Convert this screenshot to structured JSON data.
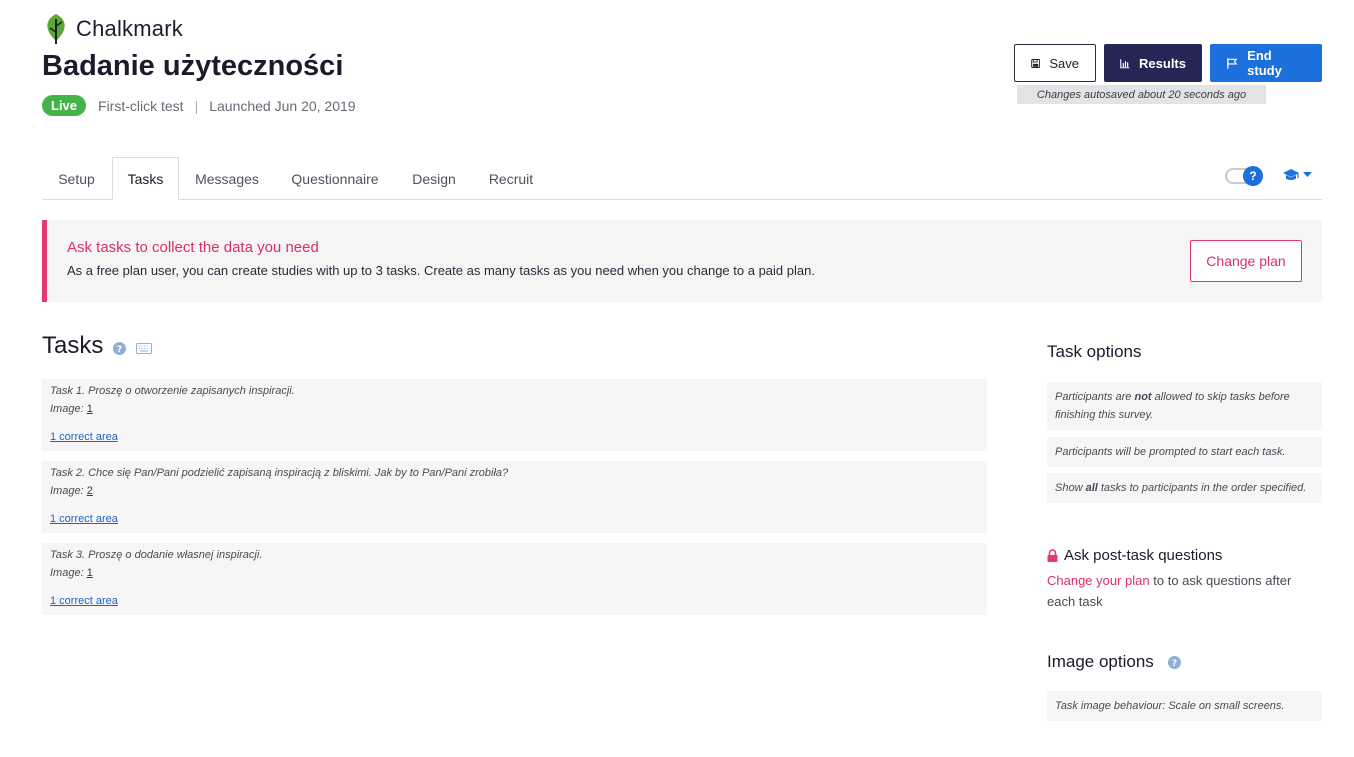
{
  "brand": {
    "name": "Chalkmark"
  },
  "study": {
    "title": "Badanie użyteczności",
    "status": "Live",
    "type": "First-click test",
    "separator": "|",
    "launched": "Launched Jun 20, 2019"
  },
  "actions": {
    "save": "Save",
    "results": "Results",
    "end_study": "End study",
    "autosave": "Changes autosaved about 20 seconds ago"
  },
  "tabs": [
    "Setup",
    "Tasks",
    "Messages",
    "Questionnaire",
    "Design",
    "Recruit"
  ],
  "active_tab": "Tasks",
  "toggle": {
    "knob": "?"
  },
  "banner": {
    "title": "Ask tasks to collect the data you need",
    "text": "As a free plan user, you can create studies with up to 3 tasks. Create as many tasks as you need when you change to a paid plan.",
    "button": "Change plan"
  },
  "tasks": {
    "title": "Tasks",
    "items": [
      {
        "question": "Task 1. Proszę o otworzenie zapisanych inspiracji.",
        "image_label": "Image:",
        "image": "1",
        "area": "1 correct area"
      },
      {
        "question": "Task 2. Chce się Pan/Pani podzielić zapisaną inspiracją z bliskimi. Jak by to Pan/Pani zrobiła?",
        "image_label": "Image:",
        "image": "2",
        "area": "1 correct area"
      },
      {
        "question": "Task 3. Proszę o dodanie własnej inspiracji.",
        "image_label": "Image:",
        "image": "1",
        "area": "1 correct area"
      }
    ]
  },
  "task_options": {
    "title": "Task options",
    "opt1_pre": "Participants are ",
    "opt1_bold": "not",
    "opt1_post": " allowed to skip tasks before finishing this survey.",
    "opt2": "Participants will be prompted to start each task.",
    "opt3_pre": "Show ",
    "opt3_bold": "all",
    "opt3_post": " tasks to participants in the order specified."
  },
  "post_task": {
    "title": "Ask post-task questions",
    "link": "Change your plan",
    "text": " to to ask questions after each task"
  },
  "image_options": {
    "title": "Image options",
    "behaviour": "Task image behaviour: Scale on small screens."
  },
  "colors": {
    "accent_blue": "#1c70dd",
    "dark_navy": "#262656",
    "live_green": "#46b34a",
    "pink": "#e23a75"
  }
}
